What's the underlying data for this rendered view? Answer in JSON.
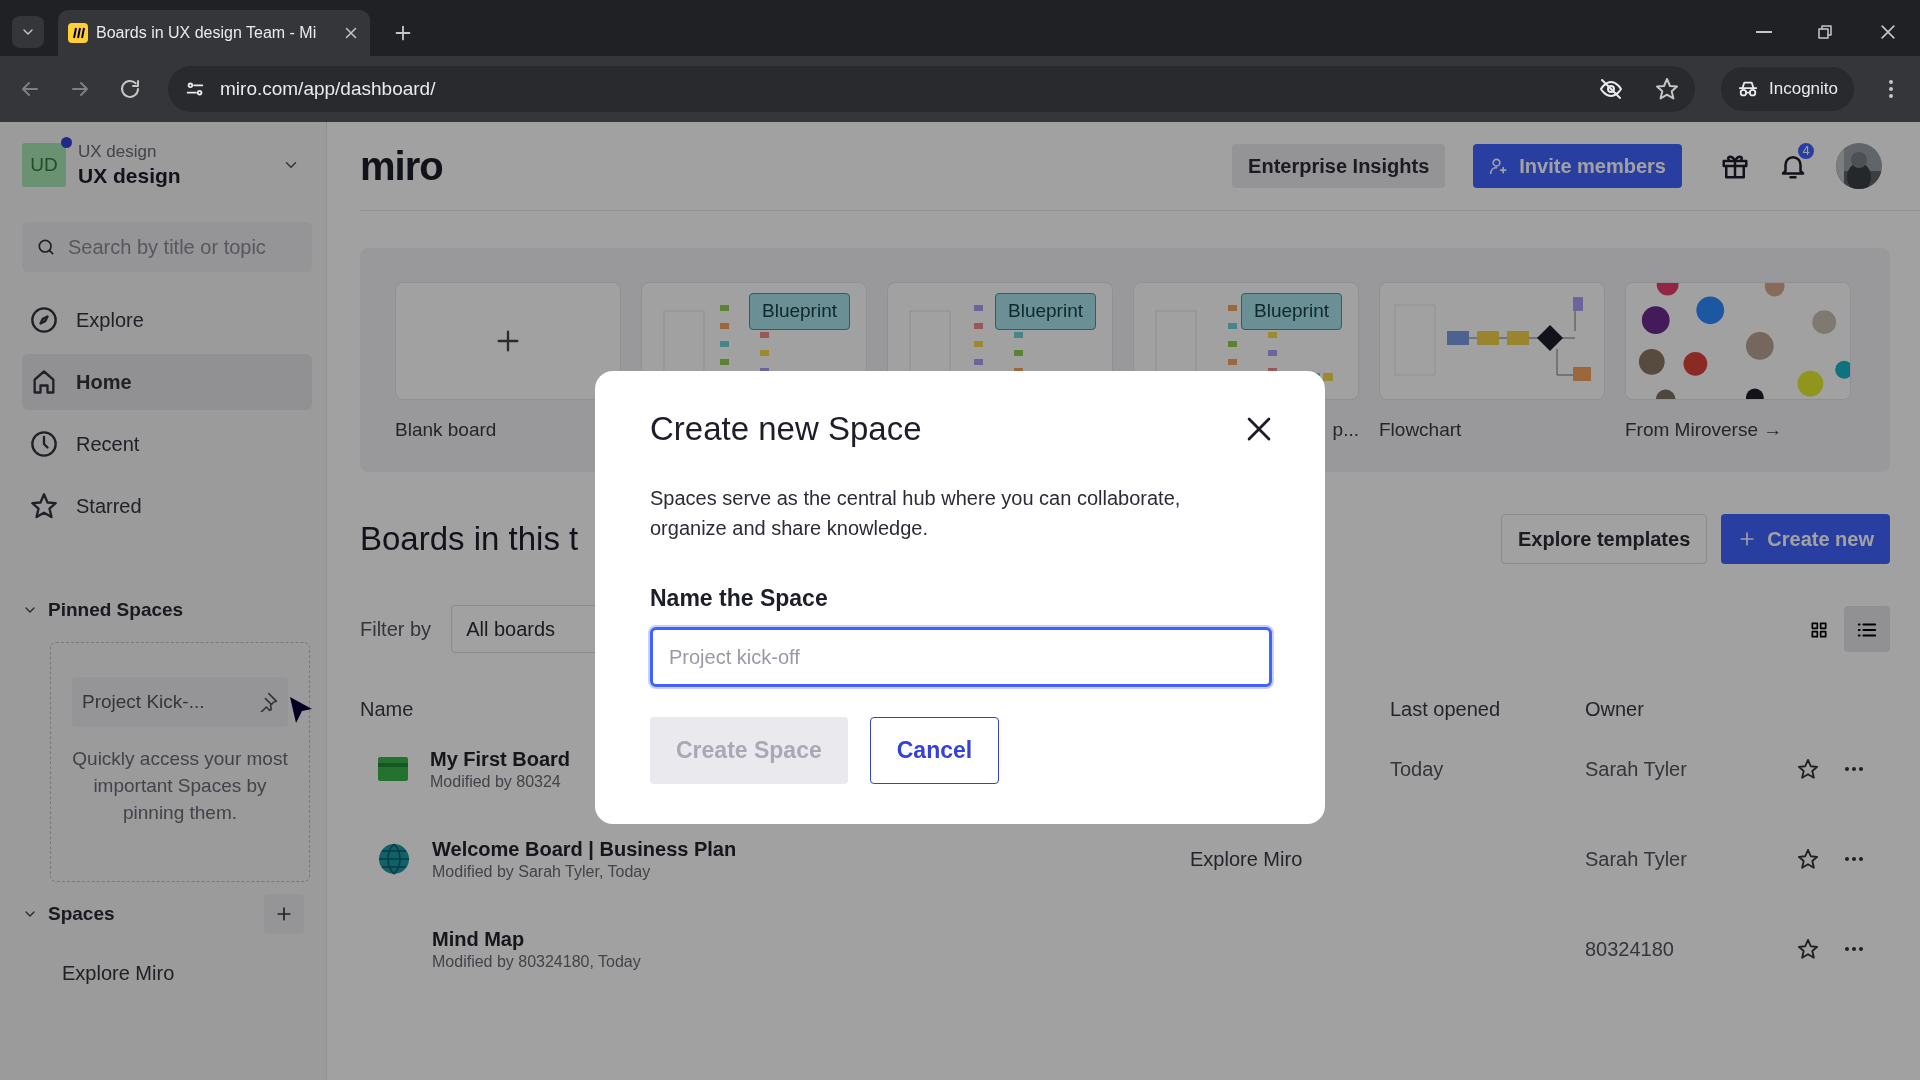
{
  "browser": {
    "tab_title": "Boards in UX design Team - Mi",
    "url": "miro.com/app/dashboard/",
    "incognito_label": "Incognito"
  },
  "sidebar": {
    "workspace": {
      "initials": "UD",
      "subtitle": "UX design",
      "name": "UX design"
    },
    "search": {
      "placeholder": "Search by title or topic"
    },
    "nav": [
      {
        "label": "Explore",
        "selected": false
      },
      {
        "label": "Home",
        "selected": true
      },
      {
        "label": "Recent",
        "selected": false
      },
      {
        "label": "Starred",
        "selected": false
      }
    ],
    "pinned": {
      "heading": "Pinned Spaces",
      "expanded": true,
      "space_label": "Project Kick-...",
      "hint": "Quickly access your most important Spaces by pinning them."
    },
    "spaces": {
      "heading": "Spaces",
      "expanded": true,
      "items": [
        {
          "label": "Explore Miro"
        }
      ]
    }
  },
  "header": {
    "logo": "miro",
    "buttons": [
      {
        "label": "Enterprise Insights",
        "kind": "secondary"
      },
      {
        "label": "Invite members",
        "kind": "primary"
      }
    ],
    "notification_count": "4"
  },
  "templates": [
    {
      "kind": "blank",
      "label": "Blank board"
    },
    {
      "kind": "blueprint",
      "badge": "Blueprint"
    },
    {
      "kind": "blueprint",
      "badge": "Blueprint"
    },
    {
      "kind": "blueprint",
      "badge": "Blueprint",
      "label": "p..."
    },
    {
      "kind": "flowchart",
      "label": "Flowchart"
    },
    {
      "kind": "miroverse",
      "label": "From Miroverse →"
    }
  ],
  "boards": {
    "title": "Boards in this t",
    "actions": [
      {
        "label": "Explore templates",
        "kind": "secondary"
      },
      {
        "label": "Create new",
        "kind": "primary"
      }
    ],
    "filter_label": "Filter by",
    "filter_value": "All boards",
    "views": [
      {
        "selected": false
      },
      {
        "selected": true
      }
    ],
    "columns": [
      "Name",
      "Last opened",
      "Owner"
    ],
    "rows": [
      {
        "name": "My First Board",
        "modified": "Modified by 80324",
        "last_opened": "Today",
        "owner": "Sarah Tyler",
        "starred": false
      },
      {
        "name": "Welcome Board | Business Plan",
        "modified": "Modified by Sarah Tyler, Today",
        "space": "Explore Miro",
        "owner": "Sarah Tyler",
        "starred": false
      },
      {
        "name": "Mind Map",
        "modified": "Modified by 80324180, Today",
        "owner": "80324180",
        "starred": false
      }
    ]
  },
  "modal": {
    "title": "Create new Space",
    "description": "Spaces serve as the central hub where you can collaborate, organize and share knowledge.",
    "field_label": "Name the Space",
    "placeholder": "Project kick-off",
    "buttons": [
      {
        "label": "Create Space",
        "kind": "primary",
        "disabled": true
      },
      {
        "label": "Cancel",
        "kind": "secondary",
        "disabled": false
      }
    ]
  }
}
